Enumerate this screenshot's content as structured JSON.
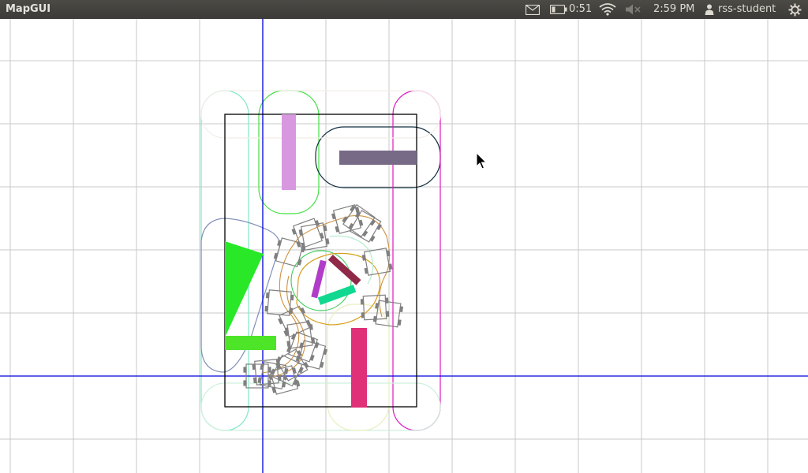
{
  "topbar": {
    "app_title": "MapGUI",
    "battery_time": "0:51",
    "clock": "2:59 PM",
    "user_name": "rss-student",
    "icons": [
      "mail-icon",
      "battery-icon",
      "wifi-icon",
      "volume-muted-icon",
      "user-icon",
      "power-gear-icon"
    ]
  },
  "map": {
    "background": "#ffffff",
    "grid_color": "#c8c8c8",
    "axis_color": "#0000dd",
    "wall_color": "#000000",
    "obstacles": [
      {
        "name": "lavender-bar",
        "color": "#d898e0"
      },
      {
        "name": "slate-bar",
        "color": "#766a86"
      },
      {
        "name": "green-triangle",
        "color": "#28e828"
      },
      {
        "name": "green-base-bar",
        "color": "#4ee428"
      },
      {
        "name": "crimson-bar",
        "color": "#e03078"
      },
      {
        "name": "purple-bar",
        "color": "#b03cc8"
      },
      {
        "name": "maroon-bar",
        "color": "#902848"
      },
      {
        "name": "teal-bar",
        "color": "#10d890"
      }
    ],
    "robot_poses": 20
  }
}
